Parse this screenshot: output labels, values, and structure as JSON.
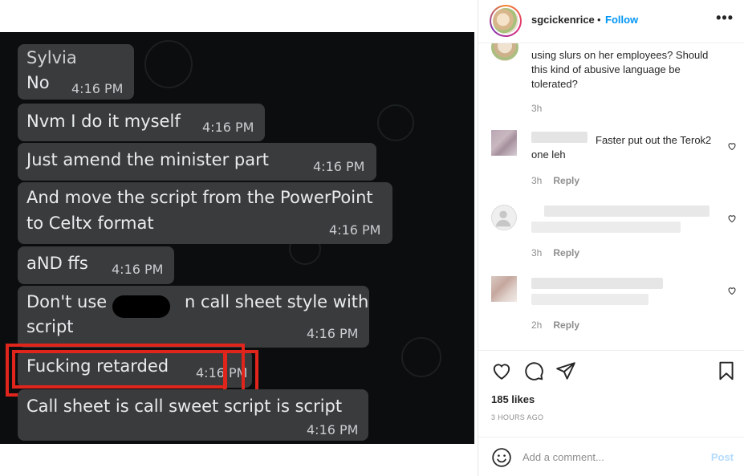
{
  "post": {
    "username": "sgcickenrice",
    "separator": "•",
    "follow_label": "Follow",
    "more_label": "•••",
    "likes": "185 likes",
    "time_ago": "3 HOURS AGO",
    "add_comment_placeholder": "Add a comment...",
    "post_label": "Post"
  },
  "chat": {
    "messages": [
      {
        "sender": "Sylvia",
        "text": "No",
        "time": "4:16 PM"
      },
      {
        "text": "Nvm I do it myself",
        "time": "4:16 PM"
      },
      {
        "text": "Just amend the minister part",
        "time": "4:16 PM"
      },
      {
        "text_line1": "And move the script from the PowerPoint",
        "text_line2": "to Celtx format",
        "time": "4:16 PM"
      },
      {
        "text": "aND ffs",
        "time": "4:16 PM"
      },
      {
        "text_line1a": "Don't use",
        "text_line1b": "n call sheet style with",
        "text_line2": "script",
        "time": "4:16 PM"
      },
      {
        "text": "Fucking retarded",
        "time": "4:16 PM"
      },
      {
        "text": "Call sheet is call sweet script is script",
        "time": "4:16 PM"
      }
    ]
  },
  "comments": [
    {
      "text": "using slurs on her employees? Should this kind of abusive language be tolerated?",
      "time": "3h"
    },
    {
      "text": "Faster put out the Terok2 one leh",
      "time": "3h",
      "reply_label": "Reply"
    },
    {
      "text": "",
      "time": "3h",
      "reply_label": "Reply"
    },
    {
      "text": "",
      "time": "2h",
      "reply_label": "Reply"
    }
  ],
  "icons": {
    "like": "heart-icon",
    "comment": "comment-icon",
    "share": "send-icon",
    "save": "bookmark-icon",
    "emoji": "smiley-icon"
  },
  "colors": {
    "link_blue": "#0095f6",
    "highlight_red": "#e0251c",
    "chat_bubble": "#3a3b3c",
    "chat_bg": "#0b0d0e"
  }
}
